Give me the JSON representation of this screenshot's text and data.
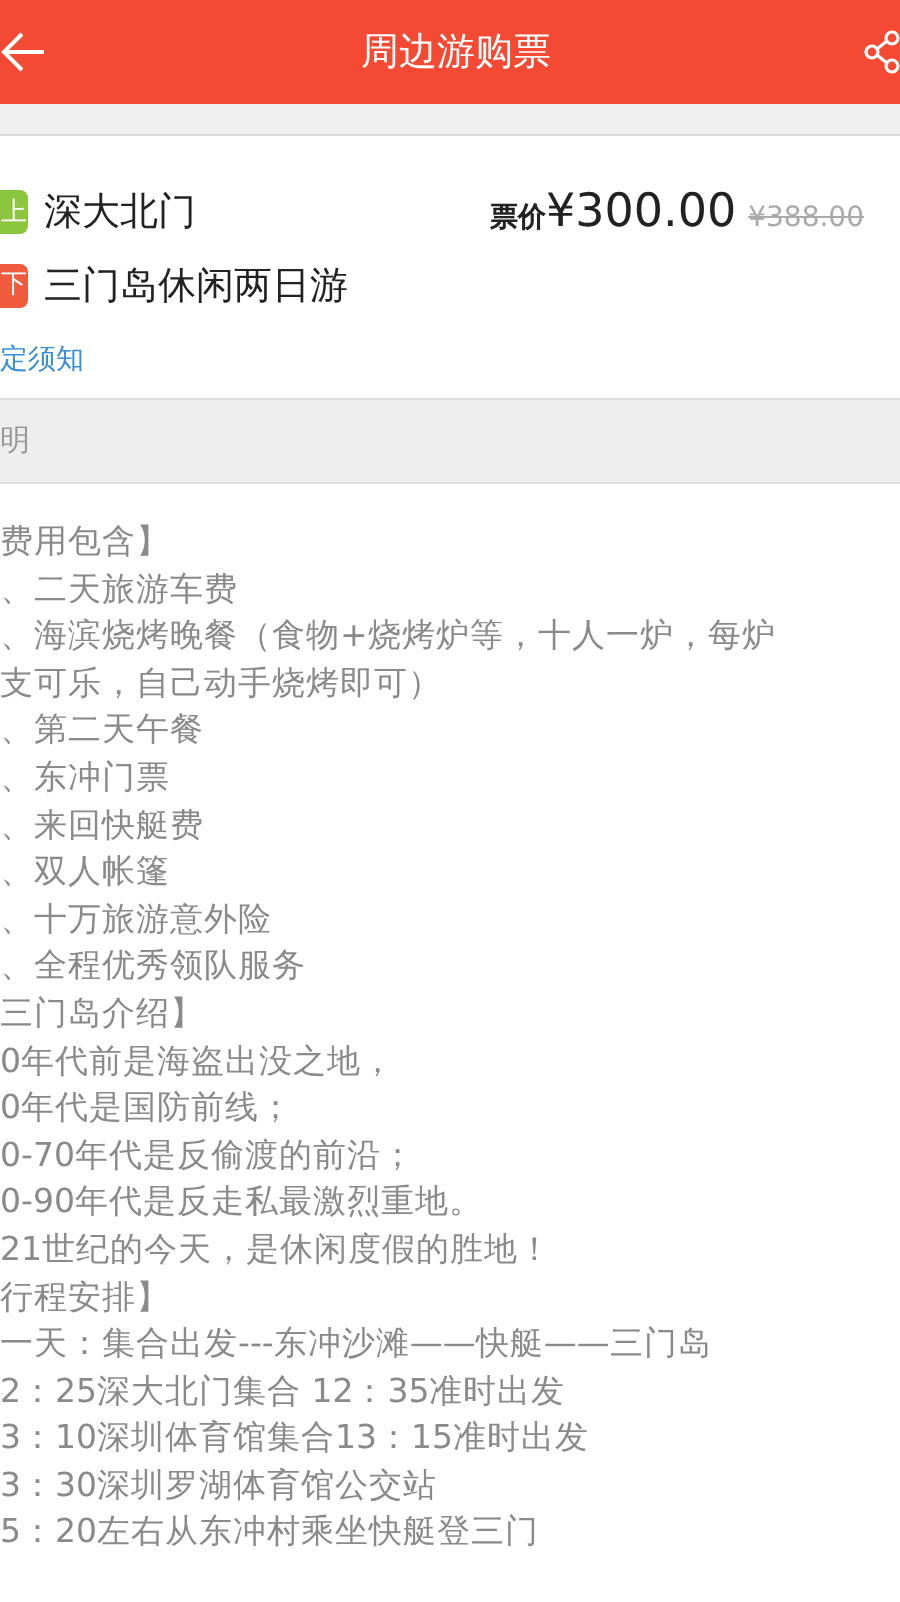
{
  "header": {
    "title": "周边游购票"
  },
  "route": [
    {
      "badge": "上",
      "name": "深大北门",
      "color": "#8cc63f"
    },
    {
      "badge": "下",
      "name": "三门岛休闲两日游",
      "color": "#ef5b3c"
    }
  ],
  "price": {
    "label": "票价",
    "current": "¥300.00",
    "original": "¥388.00"
  },
  "notice_link": "定须知",
  "section_title": "明",
  "description": [
    "费用包含】",
    "、二天旅游车费",
    "、海滨烧烤晚餐（食物+烧烤炉等，十人一炉，每炉",
    "支可乐，自己动手烧烤即可）",
    "、第二天午餐",
    "、东冲门票",
    "、来回快艇费",
    "、双人帐篷",
    "、十万旅游意外险",
    "、全程优秀领队服务",
    "三门岛介绍】",
    "0年代前是海盗出没之地，",
    "0年代是国防前线；",
    "0-70年代是反偷渡的前沿；",
    "0-90年代是反走私最激烈重地。",
    "21世纪的今天，是休闲度假的胜地！",
    "行程安排】",
    "一天：集合出发---东冲沙滩——快艇——三门岛",
    "2：25深大北门集合 12：35准时出发",
    "3：10深圳体育馆集合13：15准时出发",
    "3：30深圳罗湖体育馆公交站",
    "5：20左右从东冲村乘坐快艇登三门"
  ]
}
